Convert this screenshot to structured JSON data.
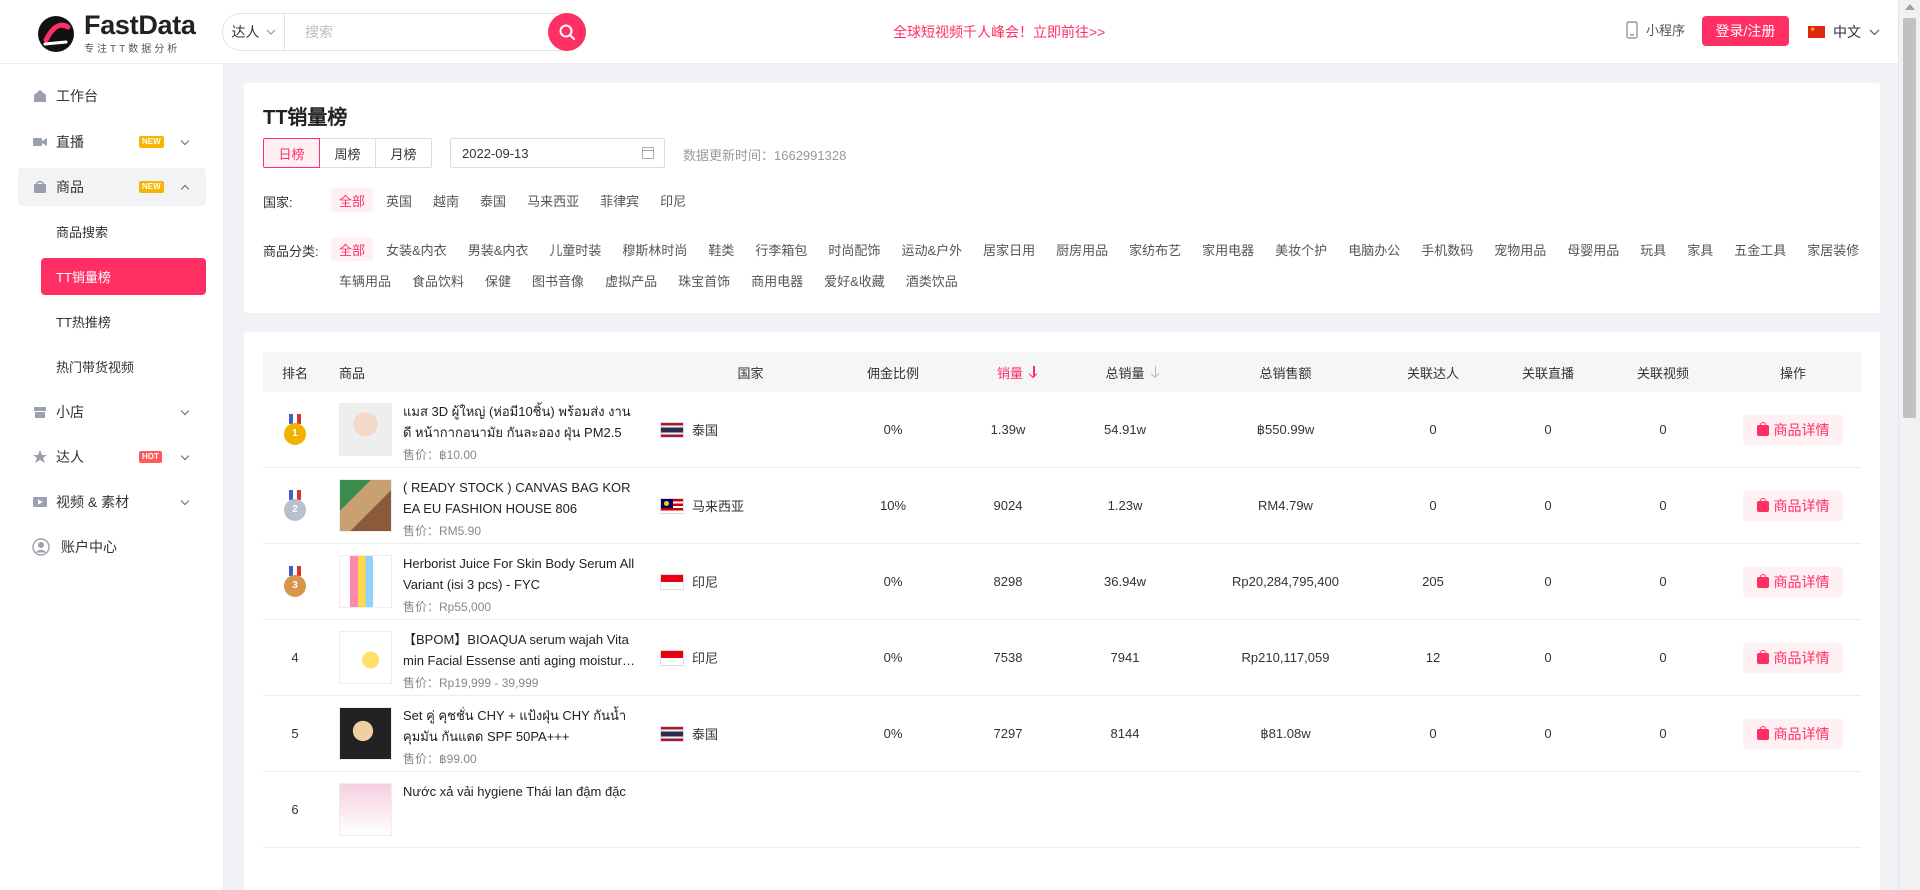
{
  "header": {
    "logo_name": "FastData",
    "logo_tagline": "专注TT数据分析",
    "search_type": "达人",
    "search_placeholder": "搜索",
    "promo": "全球短视频千人峰会！立即前往>>",
    "mini_program": "小程序",
    "login": "登录/注册",
    "language": "中文"
  },
  "sidebar": {
    "items": [
      {
        "label": "工作台"
      },
      {
        "label": "直播",
        "badge": "NEW"
      },
      {
        "label": "商品",
        "badge": "NEW"
      },
      {
        "label": "小店"
      },
      {
        "label": "达人",
        "badge": "HOT"
      },
      {
        "label": "视频 & 素材"
      },
      {
        "label": "账户中心"
      }
    ],
    "sub_items": [
      {
        "label": "商品搜索"
      },
      {
        "label": "TT销量榜"
      },
      {
        "label": "TT热推榜"
      },
      {
        "label": "热门带货视频"
      }
    ]
  },
  "filters": {
    "title": "TT销量榜",
    "periods": [
      "日榜",
      "周榜",
      "月榜"
    ],
    "date": "2022-09-13",
    "update_label": "数据更新时间：",
    "update_value": "1662991328",
    "country_label": "国家:",
    "countries": [
      "全部",
      "英国",
      "越南",
      "泰国",
      "马来西亚",
      "菲律宾",
      "印尼"
    ],
    "category_label": "商品分类:",
    "categories": [
      "全部",
      "女装&内衣",
      "男装&内衣",
      "儿童时装",
      "穆斯林时尚",
      "鞋类",
      "行李箱包",
      "时尚配饰",
      "运动&户外",
      "居家日用",
      "厨房用品",
      "家纺布艺",
      "家用电器",
      "美妆个护",
      "电脑办公",
      "手机数码",
      "宠物用品",
      "母婴用品",
      "玩具",
      "家具",
      "五金工具",
      "家居装修",
      "车辆用品",
      "食品饮料",
      "保健",
      "图书音像",
      "虚拟产品",
      "珠宝首饰",
      "商用电器",
      "爱好&收藏",
      "酒类饮品"
    ]
  },
  "table": {
    "headers": {
      "rank": "排名",
      "product": "商品",
      "country": "国家",
      "commission": "佣金比例",
      "sales": "销量",
      "total_sales": "总销量",
      "revenue": "总销售额",
      "influencers": "关联达人",
      "lives": "关联直播",
      "videos": "关联视频",
      "action": "操作"
    },
    "price_label": "售价：",
    "detail_label": "商品详情",
    "rows": [
      {
        "rank": "1",
        "title": "แมส 3D ผู้ใหญ่ (ห่อมี10ชิ้น) พร้อมส่ง งานดี หน้ากากอนามัย กันละออง ฝุ่น PM2.5",
        "price": "฿10.00",
        "country": "泰国",
        "flag": "th",
        "commission": "0%",
        "sales": "1.39w",
        "total_sales": "54.91w",
        "revenue": "฿550.99w",
        "influencers": "0",
        "lives": "0",
        "videos": "0"
      },
      {
        "rank": "2",
        "title": "( READY STOCK ) CANVAS BAG KOREA EU FASHION HOUSE 806",
        "price": "RM5.90",
        "country": "马来西亚",
        "flag": "my",
        "commission": "10%",
        "sales": "9024",
        "total_sales": "1.23w",
        "revenue": "RM4.79w",
        "influencers": "0",
        "lives": "0",
        "videos": "0"
      },
      {
        "rank": "3",
        "title": "Herborist Juice For Skin Body Serum All Variant (isi 3 pcs) - FYC",
        "price": "Rp55,000",
        "country": "印尼",
        "flag": "id",
        "commission": "0%",
        "sales": "8298",
        "total_sales": "36.94w",
        "revenue": "Rp20,284,795,400",
        "influencers": "205",
        "lives": "0",
        "videos": "0"
      },
      {
        "rank": "4",
        "title": "【BPOM】BIOAQUA serum wajah Vitamin Facial Essense anti aging moisturizing",
        "price": "Rp19,999 - 39,999",
        "country": "印尼",
        "flag": "id",
        "commission": "0%",
        "sales": "7538",
        "total_sales": "7941",
        "revenue": "Rp210,117,059",
        "influencers": "12",
        "lives": "0",
        "videos": "0"
      },
      {
        "rank": "5",
        "title": "Set คู่ คุชชั่น CHY + แป้งฝุ่น CHY กันน้ำ คุมมัน กันแดด SPF 50PA+++",
        "price": "฿99.00",
        "country": "泰国",
        "flag": "th",
        "commission": "0%",
        "sales": "7297",
        "total_sales": "8144",
        "revenue": "฿81.08w",
        "influencers": "0",
        "lives": "0",
        "videos": "0"
      },
      {
        "rank": "6",
        "title": "Nước xả vải hygiene Thái lan đậm đặc",
        "price": "",
        "country": "",
        "flag": "",
        "commission": "",
        "sales": "",
        "total_sales": "",
        "revenue": "",
        "influencers": "",
        "lives": "",
        "videos": ""
      }
    ]
  }
}
